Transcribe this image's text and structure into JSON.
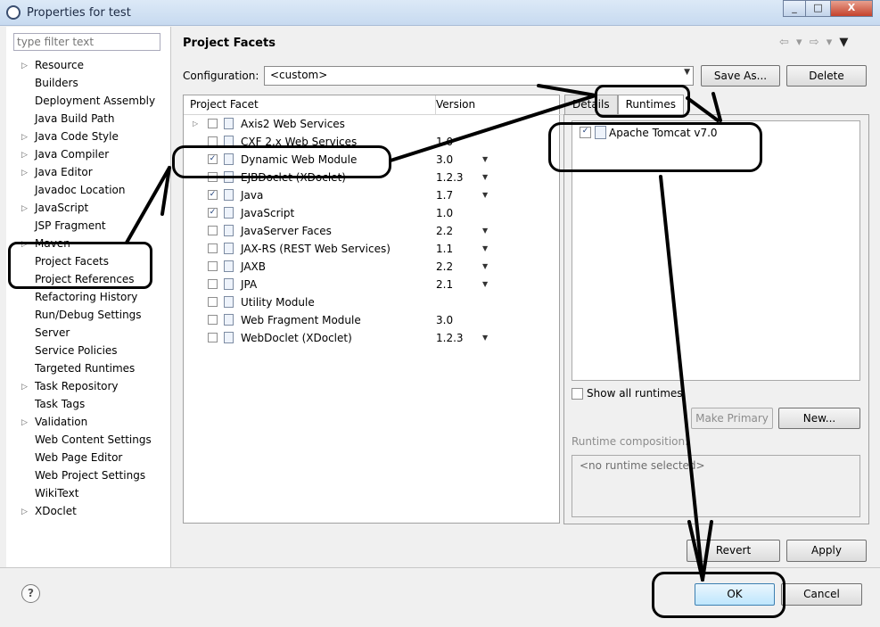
{
  "window": {
    "title": "Properties for test",
    "minimize": "_",
    "maximize": "□",
    "close": "X"
  },
  "filter": {
    "placeholder": "type filter text"
  },
  "nav": {
    "items": [
      {
        "label": "Resource",
        "arrow": true
      },
      {
        "label": "Builders",
        "arrow": false
      },
      {
        "label": "Deployment Assembly",
        "arrow": false
      },
      {
        "label": "Java Build Path",
        "arrow": false
      },
      {
        "label": "Java Code Style",
        "arrow": true
      },
      {
        "label": "Java Compiler",
        "arrow": true
      },
      {
        "label": "Java Editor",
        "arrow": true
      },
      {
        "label": "Javadoc Location",
        "arrow": false
      },
      {
        "label": "JavaScript",
        "arrow": true
      },
      {
        "label": "JSP Fragment",
        "arrow": false
      },
      {
        "label": "Maven",
        "arrow": true
      },
      {
        "label": "Project Facets",
        "arrow": false
      },
      {
        "label": "Project References",
        "arrow": false
      },
      {
        "label": "Refactoring History",
        "arrow": false
      },
      {
        "label": "Run/Debug Settings",
        "arrow": false
      },
      {
        "label": "Server",
        "arrow": false
      },
      {
        "label": "Service Policies",
        "arrow": false
      },
      {
        "label": "Targeted Runtimes",
        "arrow": false
      },
      {
        "label": "Task Repository",
        "arrow": true
      },
      {
        "label": "Task Tags",
        "arrow": false
      },
      {
        "label": "Validation",
        "arrow": true
      },
      {
        "label": "Web Content Settings",
        "arrow": false
      },
      {
        "label": "Web Page Editor",
        "arrow": false
      },
      {
        "label": "Web Project Settings",
        "arrow": false
      },
      {
        "label": "WikiText",
        "arrow": false
      },
      {
        "label": "XDoclet",
        "arrow": true
      }
    ]
  },
  "page": {
    "title": "Project Facets",
    "nav_back": "⇦ ▾",
    "nav_fwd": "⇨ ▾",
    "menu": "▼"
  },
  "config": {
    "label": "Configuration:",
    "value": "<custom>",
    "save_as": "Save As...",
    "delete": "Delete"
  },
  "facets": {
    "col_facet": "Project Facet",
    "col_version": "Version",
    "rows": [
      {
        "name": "Axis2 Web Services",
        "version": "",
        "checked": false,
        "expand": true,
        "dropdown": false
      },
      {
        "name": "CXF 2.x Web Services",
        "version": "1.0",
        "checked": false,
        "expand": false,
        "dropdown": false
      },
      {
        "name": "Dynamic Web Module",
        "version": "3.0",
        "checked": true,
        "expand": false,
        "dropdown": true
      },
      {
        "name": "EJBDoclet (XDoclet)",
        "version": "1.2.3",
        "checked": false,
        "expand": false,
        "dropdown": true
      },
      {
        "name": "Java",
        "version": "1.7",
        "checked": true,
        "expand": false,
        "dropdown": true
      },
      {
        "name": "JavaScript",
        "version": "1.0",
        "checked": true,
        "expand": false,
        "dropdown": false
      },
      {
        "name": "JavaServer Faces",
        "version": "2.2",
        "checked": false,
        "expand": false,
        "dropdown": true
      },
      {
        "name": "JAX-RS (REST Web Services)",
        "version": "1.1",
        "checked": false,
        "expand": false,
        "dropdown": true
      },
      {
        "name": "JAXB",
        "version": "2.2",
        "checked": false,
        "expand": false,
        "dropdown": true
      },
      {
        "name": "JPA",
        "version": "2.1",
        "checked": false,
        "expand": false,
        "dropdown": true
      },
      {
        "name": "Utility Module",
        "version": "",
        "checked": false,
        "expand": false,
        "dropdown": false
      },
      {
        "name": "Web Fragment Module",
        "version": "3.0",
        "checked": false,
        "expand": false,
        "dropdown": false
      },
      {
        "name": "WebDoclet (XDoclet)",
        "version": "1.2.3",
        "checked": false,
        "expand": false,
        "dropdown": true
      }
    ]
  },
  "tabs": {
    "details": "Details",
    "runtimes": "Runtimes"
  },
  "runtimes": {
    "items": [
      {
        "label": "Apache Tomcat v7.0",
        "checked": true
      }
    ],
    "show_all": "Show all runtimes",
    "make_primary": "Make Primary",
    "new": "New...",
    "composition_label": "Runtime composition:",
    "composition_value": "<no runtime selected>"
  },
  "buttons": {
    "revert": "Revert",
    "apply": "Apply",
    "ok": "OK",
    "cancel": "Cancel",
    "help": "?"
  }
}
